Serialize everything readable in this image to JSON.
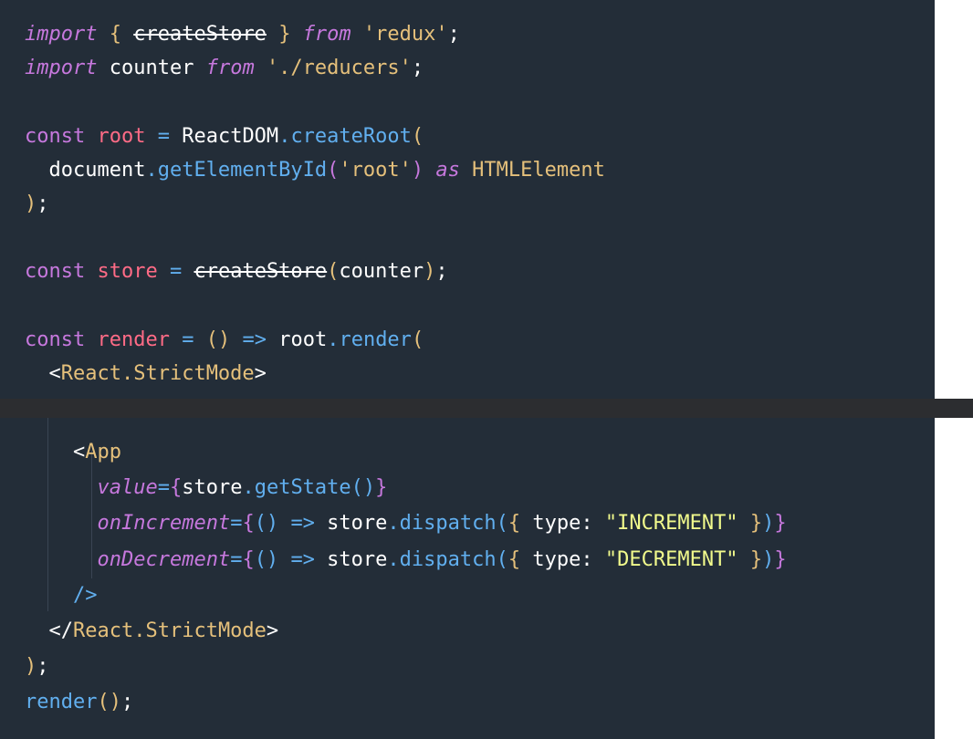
{
  "editor": {
    "code_top": [
      [
        [
          "import",
          "k-import"
        ],
        [
          " ",
          "plain"
        ],
        [
          "{",
          "punc-y"
        ],
        [
          " ",
          "plain"
        ],
        [
          "createStore",
          "fn-dep"
        ],
        [
          " ",
          "plain"
        ],
        [
          "}",
          "punc-y"
        ],
        [
          " ",
          "plain"
        ],
        [
          "from",
          "k-import"
        ],
        [
          " ",
          "plain"
        ],
        [
          "'redux'",
          "str"
        ],
        [
          ";",
          "plain"
        ]
      ],
      [
        [
          "import",
          "k-import"
        ],
        [
          " counter ",
          "plain"
        ],
        [
          "from",
          "k-import"
        ],
        [
          " ",
          "plain"
        ],
        [
          "'./reducers'",
          "str"
        ],
        [
          ";",
          "plain"
        ]
      ],
      [],
      [
        [
          "const",
          "k-const"
        ],
        [
          " ",
          "plain"
        ],
        [
          "root",
          "var"
        ],
        [
          " ",
          "plain"
        ],
        [
          "=",
          "punc-b"
        ],
        [
          " ReactDOM",
          "plain"
        ],
        [
          ".",
          "punc-b"
        ],
        [
          "createRoot",
          "fn"
        ],
        [
          "(",
          "punc-y"
        ]
      ],
      [
        [
          "  document",
          "plain"
        ],
        [
          ".",
          "punc-b"
        ],
        [
          "getElementById",
          "fn"
        ],
        [
          "(",
          "punc-p"
        ],
        [
          "'root'",
          "str"
        ],
        [
          ")",
          "punc-p"
        ],
        [
          " ",
          "plain"
        ],
        [
          "as",
          "k-as"
        ],
        [
          " ",
          "plain"
        ],
        [
          "HTMLElement",
          "type"
        ]
      ],
      [
        [
          ")",
          "punc-y"
        ],
        [
          ";",
          "plain"
        ]
      ],
      [],
      [
        [
          "const",
          "k-const"
        ],
        [
          " ",
          "plain"
        ],
        [
          "store",
          "var"
        ],
        [
          " ",
          "plain"
        ],
        [
          "=",
          "punc-b"
        ],
        [
          " ",
          "plain"
        ],
        [
          "createStore",
          "fn-dep"
        ],
        [
          "(",
          "punc-y"
        ],
        [
          "counter",
          "plain"
        ],
        [
          ")",
          "punc-y"
        ],
        [
          ";",
          "plain"
        ]
      ],
      [],
      [
        [
          "const",
          "k-const"
        ],
        [
          " ",
          "plain"
        ],
        [
          "render",
          "var"
        ],
        [
          " ",
          "plain"
        ],
        [
          "=",
          "punc-b"
        ],
        [
          " ",
          "plain"
        ],
        [
          "()",
          "punc-y"
        ],
        [
          " ",
          "plain"
        ],
        [
          "=>",
          "punc-b"
        ],
        [
          " root",
          "plain"
        ],
        [
          ".",
          "punc-b"
        ],
        [
          "render",
          "fn"
        ],
        [
          "(",
          "punc-y"
        ]
      ],
      [
        [
          "  ",
          "plain"
        ],
        [
          "<",
          "plain"
        ],
        [
          "React.StrictMode",
          "tag"
        ],
        [
          ">",
          "plain"
        ]
      ]
    ],
    "code_bottom": [
      [
        [
          "    ",
          "plain"
        ],
        [
          "<",
          "plain"
        ],
        [
          "App",
          "tag"
        ]
      ],
      [
        [
          "      ",
          "plain"
        ],
        [
          "value",
          "attr"
        ],
        [
          "=",
          "punc-b"
        ],
        [
          "{",
          "punc-p"
        ],
        [
          "store",
          "plain"
        ],
        [
          ".",
          "punc-b"
        ],
        [
          "getState",
          "fn"
        ],
        [
          "()",
          "punc-b"
        ],
        [
          "}",
          "punc-p"
        ]
      ],
      [
        [
          "      ",
          "plain"
        ],
        [
          "onIncrement",
          "attr"
        ],
        [
          "=",
          "punc-b"
        ],
        [
          "{",
          "punc-p"
        ],
        [
          "()",
          "punc-b"
        ],
        [
          " ",
          "plain"
        ],
        [
          "=>",
          "punc-b"
        ],
        [
          " store",
          "plain"
        ],
        [
          ".",
          "punc-b"
        ],
        [
          "dispatch",
          "fn"
        ],
        [
          "(",
          "punc-b"
        ],
        [
          "{",
          "punc-y"
        ],
        [
          " type: ",
          "plain"
        ],
        [
          "\"INCREMENT\"",
          "str2"
        ],
        [
          " ",
          "plain"
        ],
        [
          "}",
          "punc-y"
        ],
        [
          ")",
          "punc-b"
        ],
        [
          "}",
          "punc-p"
        ]
      ],
      [
        [
          "      ",
          "plain"
        ],
        [
          "onDecrement",
          "attr"
        ],
        [
          "=",
          "punc-b"
        ],
        [
          "{",
          "punc-p"
        ],
        [
          "()",
          "punc-b"
        ],
        [
          " ",
          "plain"
        ],
        [
          "=>",
          "punc-b"
        ],
        [
          " store",
          "plain"
        ],
        [
          ".",
          "punc-b"
        ],
        [
          "dispatch",
          "fn"
        ],
        [
          "(",
          "punc-b"
        ],
        [
          "{",
          "punc-y"
        ],
        [
          " type: ",
          "plain"
        ],
        [
          "\"DECREMENT\"",
          "str2"
        ],
        [
          " ",
          "plain"
        ],
        [
          "}",
          "punc-y"
        ],
        [
          ")",
          "punc-b"
        ],
        [
          "}",
          "punc-p"
        ]
      ],
      [
        [
          "    ",
          "plain"
        ],
        [
          "/>",
          "punc-b"
        ]
      ],
      [
        [
          "  ",
          "plain"
        ],
        [
          "</",
          "plain"
        ],
        [
          "React.StrictMode",
          "tag"
        ],
        [
          ">",
          "plain"
        ]
      ],
      [
        [
          ")",
          "punc-y"
        ],
        [
          ";",
          "plain"
        ]
      ],
      [
        [
          "render",
          "fn"
        ],
        [
          "()",
          "punc-y"
        ],
        [
          ";",
          "plain"
        ]
      ]
    ]
  }
}
